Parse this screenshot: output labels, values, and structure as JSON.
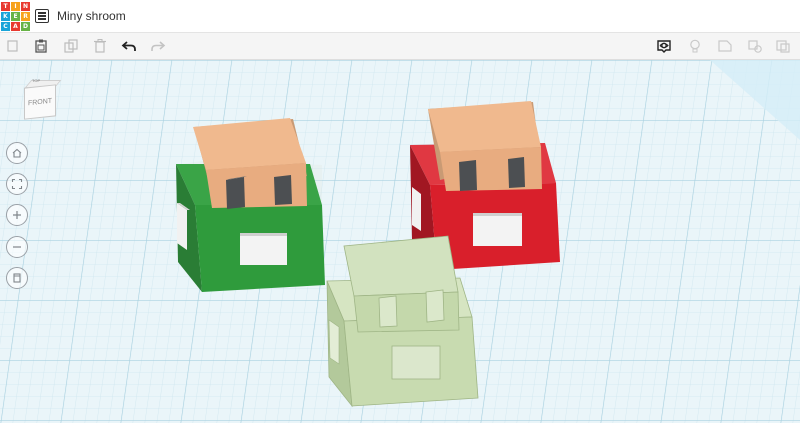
{
  "app": {
    "logo_letters": [
      "T",
      "I",
      "N",
      "K",
      "E",
      "R",
      "C",
      "A",
      "D"
    ],
    "title": "Miny shroom"
  },
  "toolbar": {
    "left": [
      "copy-icon",
      "paste-icon",
      "duplicate-icon",
      "delete-icon",
      "undo-icon",
      "redo-icon"
    ],
    "right": [
      "show-hide-icon",
      "lightbulb-icon",
      "group-icon",
      "ungroup-icon",
      "align-icon"
    ]
  },
  "viewcube": {
    "face_label": "FRONT",
    "top_label": "TOP"
  },
  "nav_controls": [
    "home-view-icon",
    "fit-all-icon",
    "zoom-in-icon",
    "zoom-out-icon",
    "perspective-icon"
  ],
  "colors": {
    "workplane": "#eaf5f9",
    "grid_minor": "#cfe6ef",
    "grid_major": "#a9d1e0",
    "green_body": "#2f9b3c",
    "red_body": "#d91f2b",
    "ghost_body": "#c8dbb0",
    "skin": "#f0b98e",
    "eyes": "#4c4f52",
    "plate": "#f2f2f2"
  },
  "objects": [
    {
      "name": "green-shroom"
    },
    {
      "name": "red-shroom"
    },
    {
      "name": "ghost-shroom"
    }
  ]
}
